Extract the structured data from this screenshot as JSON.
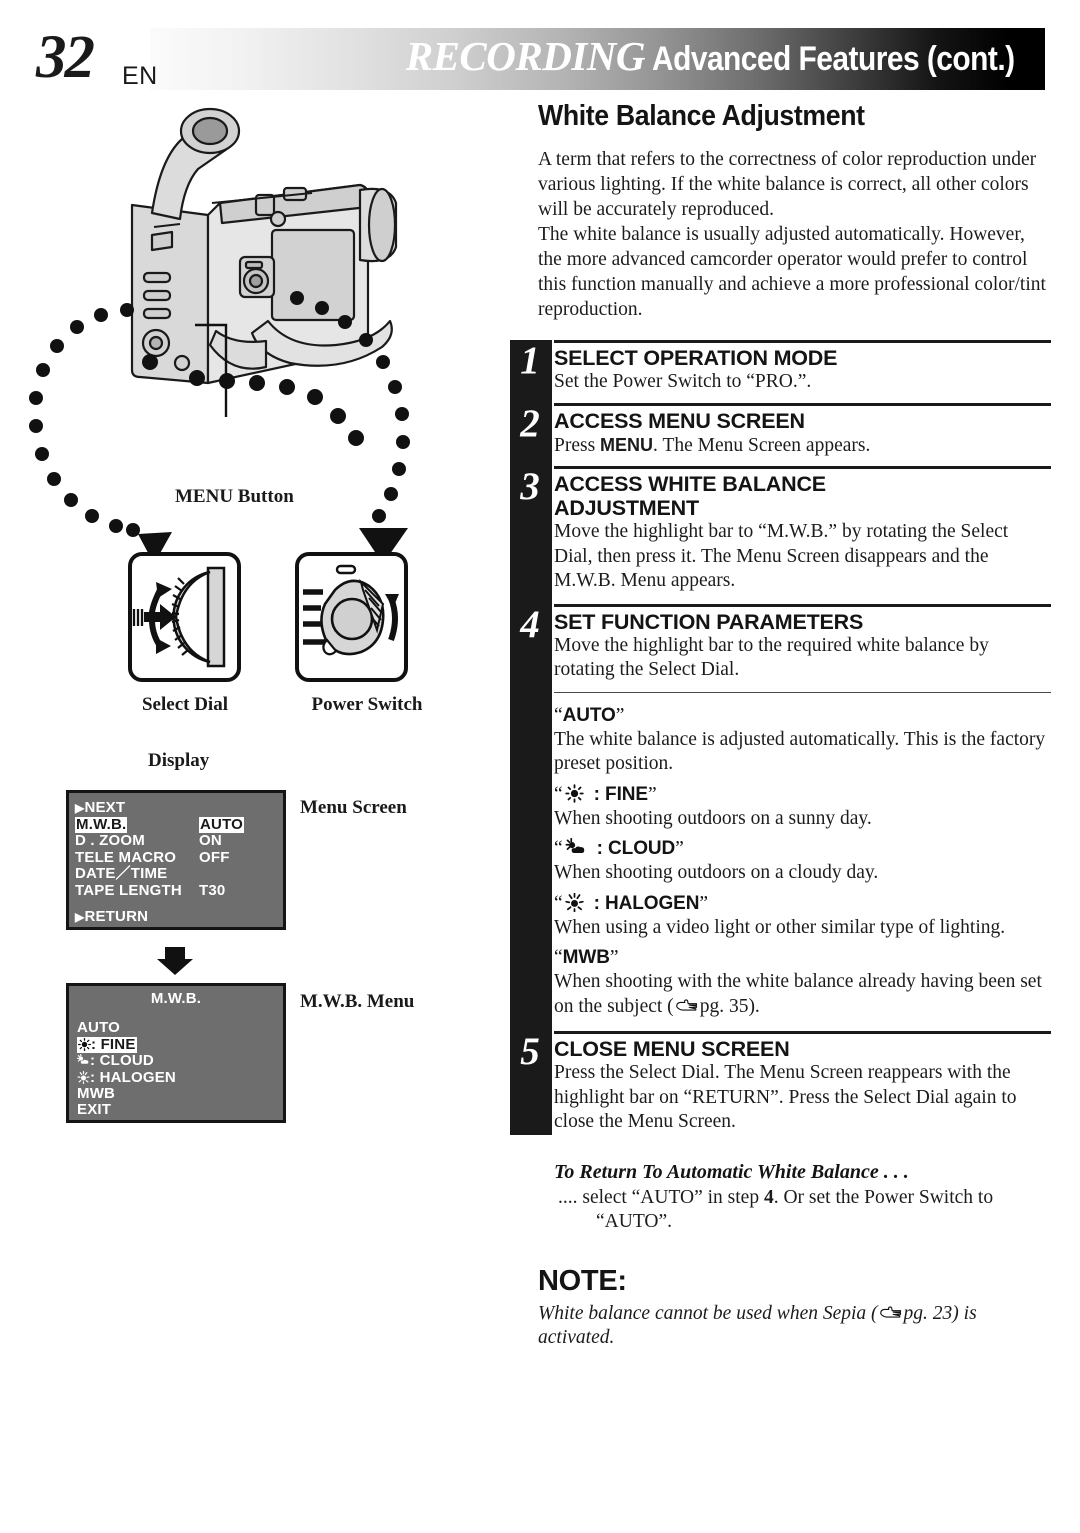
{
  "header": {
    "page_number": "32",
    "lang_code": "EN",
    "section_title": "RECORDING",
    "section_subtitle": "Advanced Features (cont.)"
  },
  "left": {
    "menu_button_label": "MENU Button",
    "select_dial_label": "Select Dial",
    "power_switch_label": "Power Switch",
    "display_label": "Display",
    "menu_screen_label": "Menu Screen",
    "mwb_menu_label": "M.W.B. Menu",
    "menu_screen": {
      "next": "NEXT",
      "return": "RETURN",
      "rows": [
        {
          "key": "M.W.B.",
          "value": "AUTO",
          "key_highlight": true,
          "value_highlight": true
        },
        {
          "key": "D . ZOOM",
          "value": "ON",
          "key_highlight": false,
          "value_highlight": false
        },
        {
          "key": "TELE MACRO",
          "value": "OFF",
          "key_highlight": false,
          "value_highlight": false
        },
        {
          "key": "DATE／TIME",
          "value": "",
          "key_highlight": false,
          "value_highlight": false
        },
        {
          "key": "TAPE LENGTH",
          "value": "T30",
          "key_highlight": false,
          "value_highlight": false
        }
      ]
    },
    "mwb_menu": {
      "title": "M.W.B.",
      "exit": "EXIT",
      "items": [
        {
          "icon": "",
          "label": "AUTO",
          "highlight": false
        },
        {
          "icon": "sun-fine-icon",
          "label": ": FINE",
          "highlight": true
        },
        {
          "icon": "sun-cloud-icon",
          "label": ": CLOUD",
          "highlight": false
        },
        {
          "icon": "halogen-icon",
          "label": ": HALOGEN",
          "highlight": false
        },
        {
          "icon": "",
          "label": "MWB",
          "highlight": false
        }
      ]
    }
  },
  "right": {
    "title": "White Balance Adjustment",
    "intro": [
      "A term that refers to the correctness of color reproduction under various lighting. If the white balance is correct, all other colors will be accurately reproduced.",
      "The white balance is usually adjusted automatically. However, the more advanced camcorder operator would prefer to control this function manually and achieve a more professional color/tint reproduction."
    ],
    "steps": [
      {
        "number": "1",
        "heading": "SELECT OPERATION MODE",
        "body_pre": "Set the Power Switch to “PRO.”.",
        "body_bold": "",
        "body_post": ""
      },
      {
        "number": "2",
        "heading": "ACCESS MENU SCREEN",
        "body_pre": "Press ",
        "body_bold": "MENU",
        "body_post": ". The Menu Screen appears."
      },
      {
        "number": "3",
        "heading": "ACCESS WHITE BALANCE ADJUSTMENT",
        "body_pre": "Move the highlight bar to “M.W.B.” by rotating the Select Dial, then press it. The Menu Screen disappears and the M.W.B. Menu appears.",
        "body_bold": "",
        "body_post": ""
      },
      {
        "number": "4",
        "heading": "SET FUNCTION PARAMETERS",
        "body_pre": "Move the highlight bar to the required white balance by rotating the Select Dial.",
        "body_bold": "",
        "body_post": ""
      }
    ],
    "options": [
      {
        "icon": "",
        "name": "AUTO",
        "desc": "The white balance is adjusted automatically. This is the factory preset position."
      },
      {
        "icon": "sun-fine-icon",
        "name": ": FINE",
        "desc": "When shooting outdoors on a sunny day."
      },
      {
        "icon": "sun-cloud-icon",
        "name": ": CLOUD",
        "desc": "When shooting outdoors on a cloudy day."
      },
      {
        "icon": "halogen-icon",
        "name": ": HALOGEN",
        "desc": "When using a video light or other similar type of lighting."
      },
      {
        "icon": "",
        "name": "MWB",
        "desc_pre": "When shooting with the white balance already having been set on the subject (",
        "desc_ref": "pg. 35",
        "desc_post": ")."
      }
    ],
    "step5": {
      "number": "5",
      "heading": "CLOSE MENU SCREEN",
      "body": "Press the Select Dial. The Menu Screen reappears with the highlight bar on “RETURN”. Press the Select Dial again to close the Menu Screen."
    },
    "return_auto": {
      "heading": "To Return To Automatic White Balance . . .",
      "line1_pre": ".... select “AUTO” in step ",
      "line1_bold": "4",
      "line1_post": ". Or set the Power Switch to",
      "line2": "“AUTO”."
    },
    "note": {
      "heading": "NOTE:",
      "body_pre": "White balance cannot be used when Sepia (",
      "body_ref": "pg. 23",
      "body_post": ") is activated."
    }
  }
}
